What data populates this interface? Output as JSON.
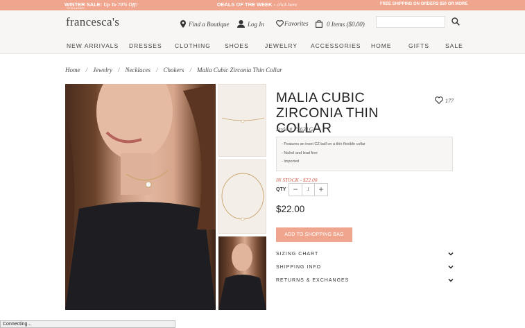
{
  "promo": {
    "left_prefix": "WINTER SALE: ",
    "left_emph": "Up To 70% Off!",
    "disclaimer": "*DISCLAIMER*",
    "mid_prefix": "DEALS OF THE WEEK - ",
    "mid_link": "click here",
    "right": "FREE SHIPPING ON ORDERS $50 OR MORE",
    "color": "#f0a58e"
  },
  "header": {
    "logo": "francesca's",
    "find_boutique": "Find a Boutique",
    "login": "Log In",
    "favorites": "Favorites",
    "cart": "0 Items  ($0.00)",
    "search_placeholder": ""
  },
  "nav": [
    "NEW ARRIVALS",
    "DRESSES",
    "CLOTHING",
    "SHOES",
    "JEWELRY",
    "ACCESSORIES",
    "HOME",
    "GIFTS",
    "SALE"
  ],
  "breadcrumb": [
    "Home",
    "Jewelry",
    "Necklaces",
    "Chokers",
    "Malia Cubic Zirconia Thin Collar"
  ],
  "product": {
    "title": "MALIA CUBIC ZIRCONIA THIN COLLAR",
    "favorites_count": "177",
    "style": "Style # 75631G",
    "features": [
      "- Features an inset CZ ball on a thin flexible collar",
      "- Nickel and lead free",
      "- Imported"
    ],
    "stock": "IN STOCK - $22.00",
    "qty_label": "QTY",
    "qty_value": "1",
    "qty_minus": "−",
    "qty_plus": "+",
    "price": "$22.00",
    "add_to_bag": "ADD TO SHOPPING BAG",
    "accordions": [
      "SIZING CHART",
      "SHIPPING INFO",
      "RETURNS & EXCHANGES"
    ]
  },
  "status_bar": "Connecting..."
}
